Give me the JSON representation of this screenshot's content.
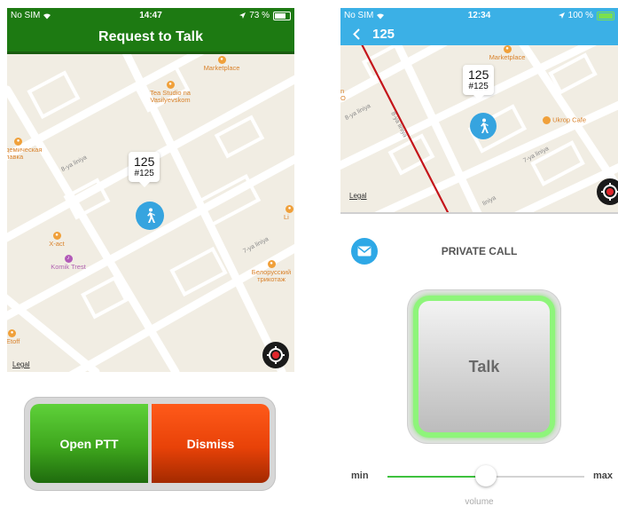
{
  "left": {
    "status": {
      "carrier": "No SIM",
      "time": "14:47",
      "battery": "73 %",
      "battery_level": 0.73
    },
    "title": "Request to Talk",
    "map": {
      "pois": [
        {
          "label": "Marketplace",
          "color": "orange"
        },
        {
          "label": "Tea Studio na Vasilyevskom",
          "color": "orange"
        },
        {
          "label": "демическая лавка",
          "color": "orange"
        },
        {
          "label": "X-act",
          "color": "orange"
        },
        {
          "label": "Komik Trest",
          "color": "purple"
        },
        {
          "label": "Белорусский трикотаж",
          "color": "orange"
        },
        {
          "label": "Etoff",
          "color": "orange"
        },
        {
          "label": "Li",
          "color": "orange"
        }
      ],
      "streets": [
        "8-ya liniya",
        "7-ya liniya"
      ],
      "callout_title": "125",
      "callout_sub": "#125",
      "legal": "Legal"
    },
    "buttons": {
      "open_ptt": "Open PTT",
      "dismiss": "Dismiss"
    }
  },
  "right": {
    "status": {
      "carrier": "No SIM",
      "time": "12:34",
      "battery": "100 %",
      "battery_level": 1.0
    },
    "title": "125",
    "map": {
      "pois": [
        {
          "label": "Marketplace",
          "color": "orange"
        },
        {
          "label": "Ukrop Cafe",
          "color": "orange"
        },
        {
          "label": "n O",
          "color": "orange"
        }
      ],
      "streets": [
        "8-ya liniya",
        "8-ya liniya",
        "7-ya liniya",
        "liniya"
      ],
      "callout_title": "125",
      "callout_sub": "#125",
      "legal": "Legal"
    },
    "call_title": "PRIVATE CALL",
    "talk_label": "Talk",
    "volume": {
      "min": "min",
      "max": "max",
      "label": "volume",
      "level": 0.5
    }
  },
  "colors": {
    "green_bar": "#1d7a12",
    "blue_bar": "#3bb0e6",
    "pin": "#36a4df",
    "open_ptt": "#3ea61d",
    "dismiss": "#e84208",
    "talk_glow": "#8ef57a"
  },
  "icons": {
    "wifi": "wifi-icon",
    "location_arrow": "location-arrow-icon",
    "back": "chevron-left-icon",
    "pedestrian": "pedestrian-icon",
    "target": "target-icon",
    "mail": "mail-icon"
  }
}
